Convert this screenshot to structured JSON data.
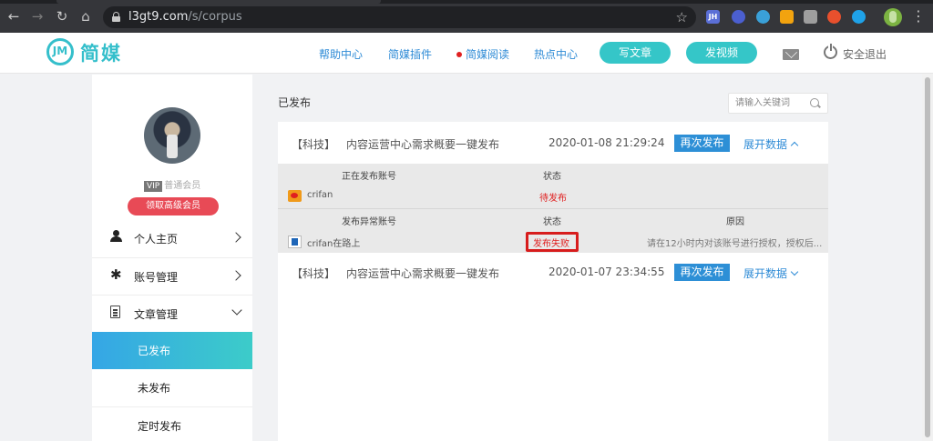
{
  "browser": {
    "url_host": "l3gt9.com",
    "url_path": "/s/corpus",
    "extensions": [
      {
        "name": "jh-extension-icon",
        "label": "JH",
        "color": "#5b6fd6"
      },
      {
        "name": "globe-extension-icon",
        "label": "",
        "color": "#4b5fd0"
      },
      {
        "name": "react-extension-icon",
        "label": "",
        "color": "#3aa0d8"
      },
      {
        "name": "puzzle-extension-icon",
        "label": "",
        "color": "#f2a30f"
      },
      {
        "name": "qr-extension-icon",
        "label": "",
        "color": "#9e9e9e"
      },
      {
        "name": "fox-extension-icon",
        "label": "",
        "color": "#e8502d"
      },
      {
        "name": "chart-extension-icon",
        "label": "",
        "color": "#1fa2e8"
      }
    ]
  },
  "header": {
    "logo_mark": "JM",
    "logo_text": "简媒",
    "links": [
      "帮助中心",
      "简媒插件",
      "简媒阅读",
      "热点中心"
    ],
    "write_article": "写文章",
    "post_video": "发视频",
    "logout": "安全退出"
  },
  "sidebar": {
    "vip": "VIP",
    "member_level": "普通会员",
    "upgrade": "领取高级会员",
    "items": [
      {
        "label": "个人主页",
        "icon": "user-icon"
      },
      {
        "label": "账号管理",
        "icon": "star-icon"
      },
      {
        "label": "文章管理",
        "icon": "document-icon"
      }
    ],
    "sub_items": [
      "已发布",
      "未发布",
      "定时发布"
    ]
  },
  "main": {
    "title": "已发布",
    "search_placeholder": "请输入关键词",
    "articles": [
      {
        "category": "【科技】",
        "title": "内容运营中心需求概要一键发布",
        "time": "2020-01-08 21:29:24",
        "republish": "再次发布",
        "toggle": "展开数据",
        "expanded": true
      },
      {
        "category": "【科技】",
        "title": "内容运营中心需求概要一键发布",
        "time": "2020-01-07 23:34:55",
        "republish": "再次发布",
        "toggle": "展开数据",
        "expanded": false
      }
    ],
    "publishing": {
      "col_account": "正在发布账号",
      "col_status": "状态",
      "account": "crifan",
      "status": "待发布"
    },
    "failed": {
      "col_account": "发布异常账号",
      "col_status": "状态",
      "col_reason": "原因",
      "account": "crifan在路上",
      "status": "发布失败",
      "reason": "请在12小时内对该账号进行授权，授权后..."
    }
  },
  "colors": {
    "brand": "#35bfcb",
    "link": "#2e8bd6",
    "primary_button": "#2d8fd6",
    "error": "#e02020"
  }
}
